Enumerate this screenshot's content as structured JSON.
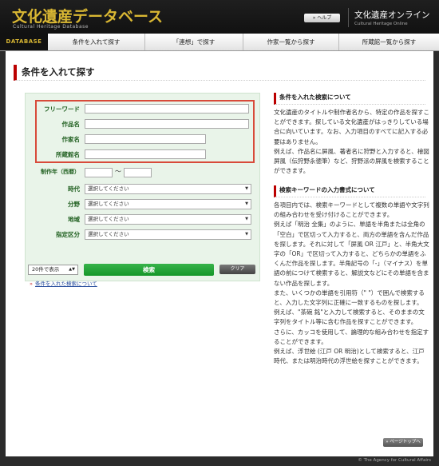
{
  "header": {
    "logo_main": "文化遺産データベース",
    "logo_sub": "Cultural Heritage Database",
    "help_label": "» ヘルプ",
    "site_title": "文化遺産オンライン",
    "site_sub": "Cultural Heritage Online"
  },
  "nav": {
    "db_label": "DATABASE",
    "tabs": [
      {
        "label": "条件を入れて探す"
      },
      {
        "label": "「連想」で探す"
      },
      {
        "label": "作家一覧から探す"
      },
      {
        "label": "所蔵館一覧から探す"
      }
    ]
  },
  "main": {
    "heading": "条件を入れて探す"
  },
  "form": {
    "fields": {
      "freeword": {
        "label": "フリーワード",
        "value": ""
      },
      "title": {
        "label": "作品名",
        "value": ""
      },
      "artist": {
        "label": "作家名",
        "value": ""
      },
      "museum": {
        "label": "所蔵館名",
        "value": ""
      }
    },
    "year": {
      "label": "制作年（西暦）",
      "from": "",
      "separator": "〜",
      "to": ""
    },
    "era": {
      "label": "時代",
      "value": "選択してください"
    },
    "field": {
      "label": "分野",
      "value": "選択してください"
    },
    "region": {
      "label": "地域",
      "value": "選択してください"
    },
    "designation": {
      "label": "指定区分",
      "value": "選択してください"
    },
    "per_page": "20件で表示",
    "search_label": "検索",
    "clear_label": "クリア",
    "about_link": "条件を入れた検索について"
  },
  "right": {
    "section1": {
      "title": "条件を入れた検索について",
      "paragraphs": [
        "文化遺産のタイトルや制作者名から、特定の作品を探すことができます。探している文化遺産がはっきりしている場合に向いています。なお、入力項目のすべてに記入する必要はありません。",
        "例えば、作品名に屏風、著者名に狩野と入力すると、檜図屏風（伝狩野永徳筆）など、狩野派の屏風を検索することができます。"
      ]
    },
    "section2": {
      "title": "検索キーワードの入力書式について",
      "paragraphs": [
        "各項目内では、検索キーワードとして複数の単語や文字列の組み合わせを受け付けることができます。",
        "例えば「明治 全集」のように、単語を半角または全角の「空白」で区切って入力すると、両方の単語を含んだ作品を探します。それに対して「屏風 OR 江戸」と、半角大文字の「OR」で区切って入力すると、どちらかの単語をふくんだ作品を探します。半角記号の「-」（マイナス）を単語の前につけて検索すると、解説文などにその単語を含まない作品を探します。",
        "また、いくつかの単語を引用符（\" \"）で囲んで検索すると、入力した文字列に正確に一致するものを探します。",
        "例えば、\"茶碗 銘\"と入力して検索すると、そのままの文字列をタイトル等に含む作品を探すことができます。",
        "さらに、カッコを使用して、論理的な組み合わせを指定することができます。",
        "例えば、浮世絵 (江戸 OR 明治)として検索すると、江戸時代、または明治時代の浮世絵を探すことができます。"
      ]
    }
  },
  "pagetop_label": "» ページトップへ",
  "footer": "© The Agency for Cultural Affairs"
}
